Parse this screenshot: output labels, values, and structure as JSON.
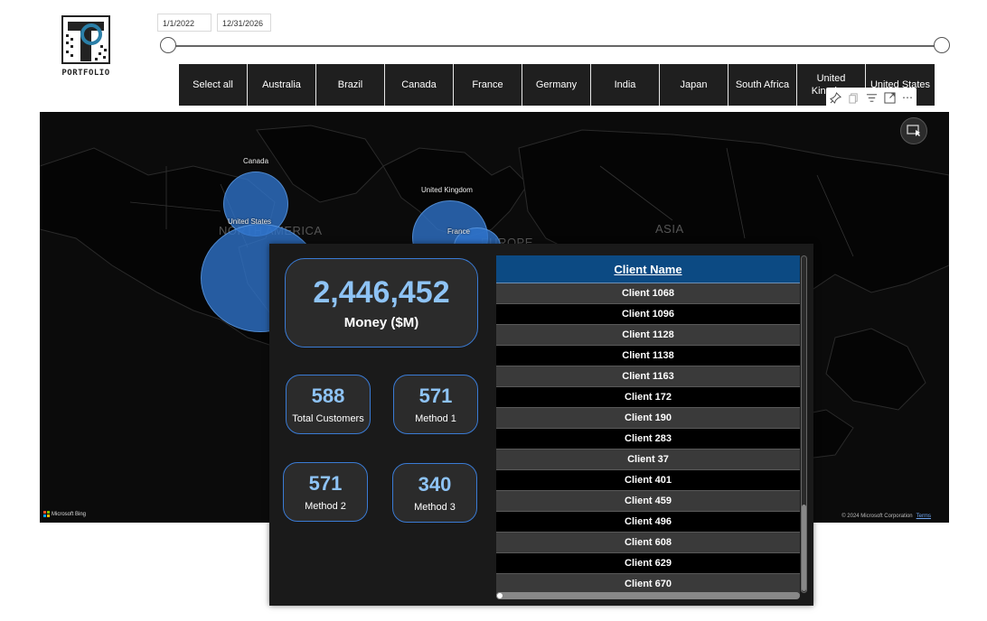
{
  "logo": {
    "text": "PORTFOLIO"
  },
  "date_slicer": {
    "start": "1/1/2022",
    "end": "12/31/2026"
  },
  "country_tiles": [
    {
      "label": "Select all"
    },
    {
      "label": "Australia"
    },
    {
      "label": "Brazil"
    },
    {
      "label": "Canada"
    },
    {
      "label": "France"
    },
    {
      "label": "Germany"
    },
    {
      "label": "India"
    },
    {
      "label": "Japan"
    },
    {
      "label": "South Africa"
    },
    {
      "label": "United Kingdom"
    },
    {
      "label": "United States"
    }
  ],
  "toolbar": {
    "icons": [
      "pin-icon",
      "copy-icon",
      "filter-icon",
      "focus-mode-icon",
      "more-options-icon"
    ],
    "more": "⋯"
  },
  "map": {
    "labels": {
      "canada": "Canada",
      "united_states": "United States",
      "united_kingdom": "United Kingdom",
      "france": "France",
      "north_america": "NORTH AMERICA",
      "europe": "EUROPE",
      "asia": "ASIA"
    },
    "bing": "Microsoft Bing",
    "copyright": "© 2024 Microsoft Corporation",
    "terms": "Terms",
    "bubble_color": "#3074cd"
  },
  "cards": {
    "money": {
      "value": "2,446,452",
      "label": "Money ($M)"
    },
    "total_customers": {
      "value": "588",
      "label": "Total Customers"
    },
    "method1": {
      "value": "571",
      "label": "Method 1"
    },
    "method2": {
      "value": "571",
      "label": "Method 2"
    },
    "method3": {
      "value": "340",
      "label": "Method 3"
    }
  },
  "client_table": {
    "header": "Client Name",
    "rows": [
      "Client 1068",
      "Client 1096",
      "Client 1128",
      "Client 1138",
      "Client 1163",
      "Client 172",
      "Client 190",
      "Client 283",
      "Client 37",
      "Client 401",
      "Client 459",
      "Client 496",
      "Client 608",
      "Client 629",
      "Client 670"
    ]
  },
  "colors": {
    "accent": "#3a7bd5",
    "value_blue": "#8ec3f5",
    "header_blue": "#0c4a83"
  }
}
